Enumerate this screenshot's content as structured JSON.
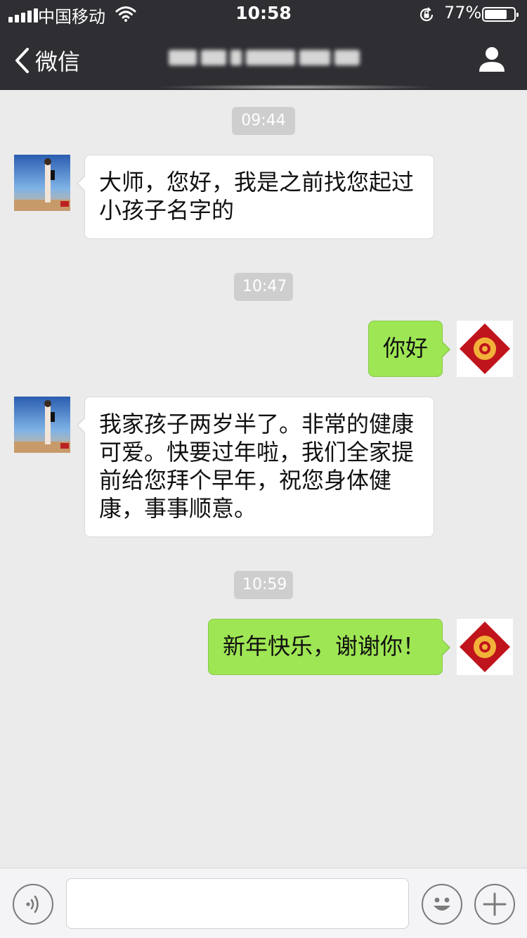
{
  "status_bar": {
    "carrier": "中国移动",
    "time": "10:58",
    "battery_percent_label": "77%",
    "battery_level": 0.77
  },
  "nav": {
    "back_label": "微信",
    "contact_name_blurred": true
  },
  "messages": [
    {
      "type": "timestamp",
      "text": "09:44"
    },
    {
      "type": "incoming",
      "text": "大师，您好，我是之前找您起过小孩子名字的"
    },
    {
      "type": "timestamp",
      "text": "10:47"
    },
    {
      "type": "outgoing",
      "text": "你好"
    },
    {
      "type": "incoming",
      "text": "我家孩子两岁半了。非常的健康可爱。快要过年啦，我们全家提前给您拜个早年，祝您身体健康，事事顺意。"
    },
    {
      "type": "timestamp",
      "text": "10:59"
    },
    {
      "type": "outgoing",
      "text": "新年快乐，谢谢你！"
    }
  ],
  "input_bar": {
    "voice_icon": "voice-icon",
    "emoji_icon": "emoji-icon",
    "plus_icon": "plus-icon",
    "text_value": ""
  },
  "colors": {
    "header_bg": "#2e2e33",
    "chat_bg": "#ebebeb",
    "outgoing_bubble": "#9ee654",
    "incoming_bubble": "#ffffff",
    "timestamp_bg": "#cecece"
  }
}
